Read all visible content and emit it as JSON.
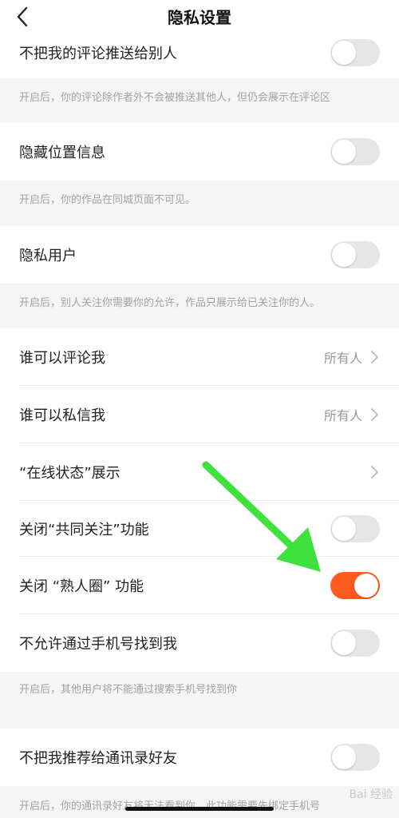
{
  "header": {
    "title": "隐私设置"
  },
  "rows": [
    {
      "label": "不把我的评论推送给别人",
      "toggle": false
    },
    {
      "label": "隐藏位置信息",
      "toggle": false
    },
    {
      "label": "隐私用户",
      "toggle": false
    },
    {
      "label": "谁可以评论我",
      "value": "所有人"
    },
    {
      "label": "谁可以私信我",
      "value": "所有人"
    },
    {
      "label": "“在线状态”展示"
    },
    {
      "label": "关闭“共同关注”功能",
      "toggle": false
    },
    {
      "label": "关闭 “熟人圈” 功能",
      "toggle": true
    },
    {
      "label": "不允许通过手机号找到我",
      "toggle": false
    },
    {
      "label": "不把我推荐给通讯录好友",
      "toggle": false
    }
  ],
  "notes": [
    "开启后，你的评论除作者外不会被推送其他人，但仍会展示在评论区",
    "开启后，你的作品在同城页面不可见。",
    "开启后，别人关注你需要你的允许，作品只展示给已关注你的人。",
    "开启后，其他用户将不能通过搜索手机号找到你",
    "开启后，你的通讯录好友将无法看到你，此功能需要先绑定手机号"
  ],
  "colors": {
    "accent": "#ff5a1f",
    "annotation_arrow": "#3ee13e"
  },
  "watermark": "Bai 经验"
}
